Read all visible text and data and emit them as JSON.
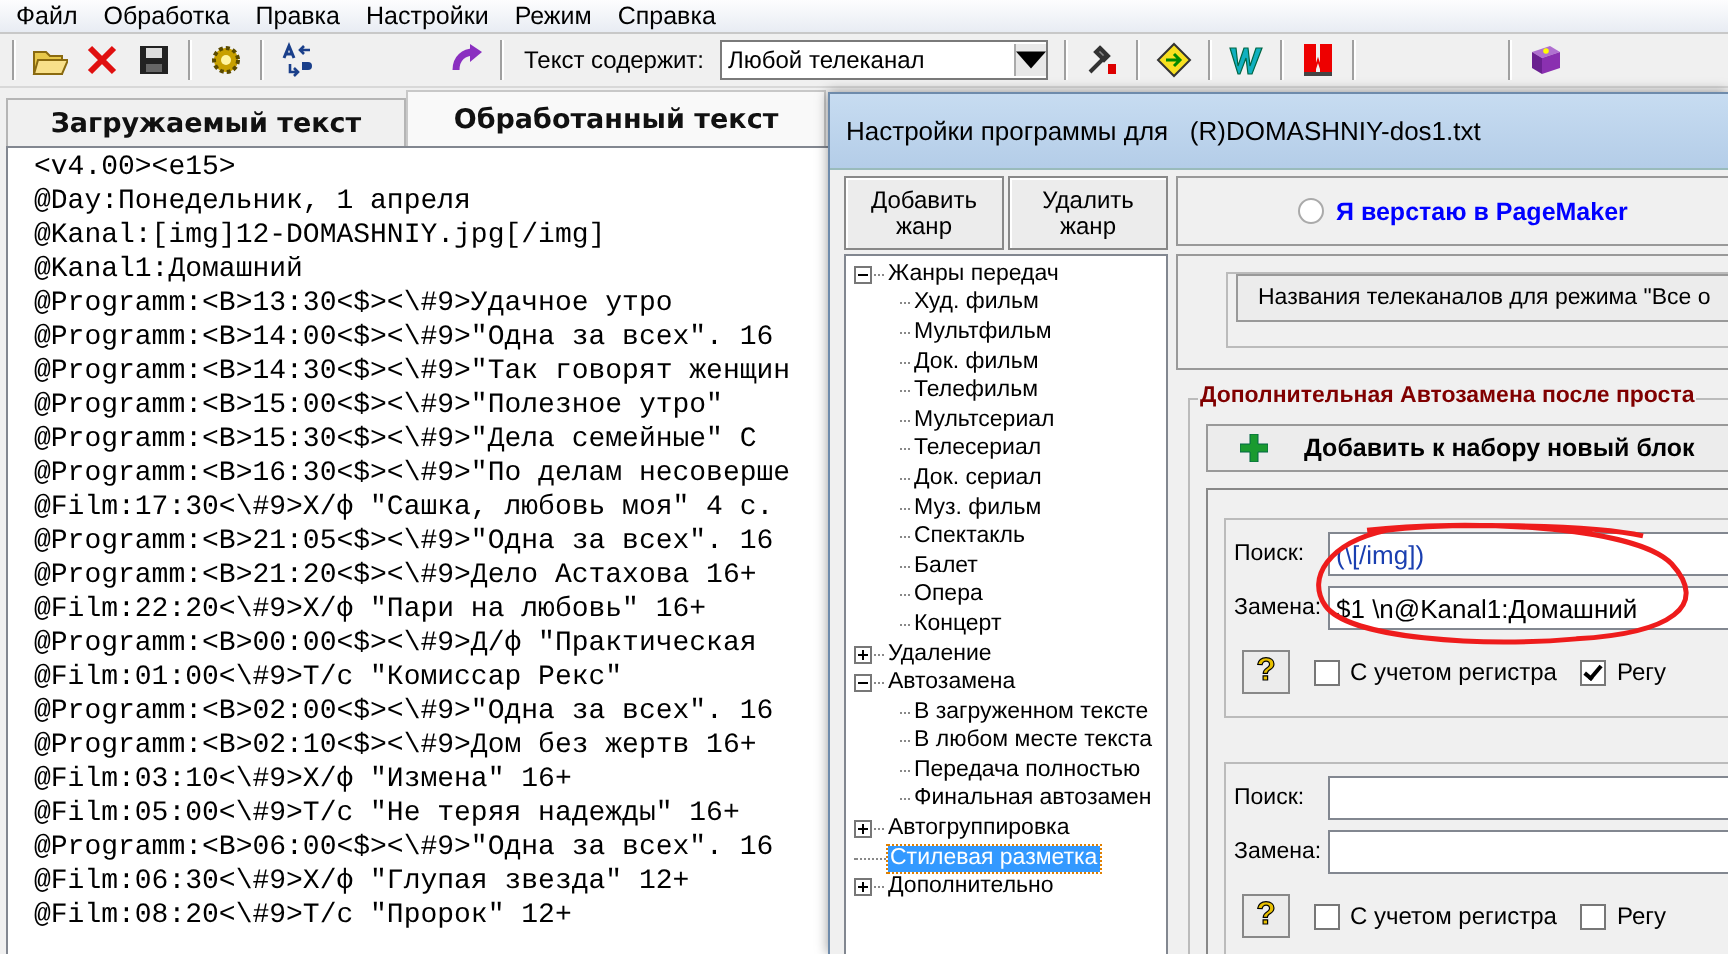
{
  "menu": [
    "Файл",
    "Обработка",
    "Правка",
    "Настройки",
    "Режим",
    "Справка"
  ],
  "toolbar": {
    "filter_label": "Текст содержит:",
    "filter_value": "Любой телеканал"
  },
  "tabs": [
    {
      "label": "Загружаемый текст",
      "selected": false
    },
    {
      "label": "Обработанный текст",
      "selected": true
    }
  ],
  "editor": {
    "lines": [
      "<v4.00><e15>",
      "@Day:Понедельник, 1 апреля",
      "@Kanal:[img]12-DOMASHNIY.jpg[/img]",
      "@Kanal1:Домашний",
      "@Programm:<B>13:30<$><\\#9>Удачное утро",
      "@Programm:<B>14:00<$><\\#9>\"Одна за всех\". 16",
      "@Programm:<B>14:30<$><\\#9>\"Так говорят женщин",
      "@Programm:<B>15:00<$><\\#9>\"Полезное утро\"",
      "@Programm:<B>15:30<$><\\#9>\"Дела семейные\" С",
      "@Programm:<B>16:30<$><\\#9>\"По делам несоверше",
      "@Film:17:30<\\#9>Х/ф \"Сашка, любовь моя\" 4 с.",
      "@Programm:<B>21:05<$><\\#9>\"Одна за всех\". 16",
      "@Programm:<B>21:20<$><\\#9>Дело Астахова 16+",
      "@Film:22:20<\\#9>Х/ф \"Пари на любовь\" 16+",
      "@Programm:<B>00:00<$><\\#9>Д/ф \"Практическая",
      "@Film:01:00<\\#9>Т/с \"Комиссар Рекс\"",
      "@Programm:<B>02:00<$><\\#9>\"Одна за всех\". 16",
      "@Programm:<B>02:10<$><\\#9>Дом без жертв 16+",
      "@Film:03:10<\\#9>Х/ф \"Измена\" 16+",
      "@Film:05:00<\\#9>Т/с \"Не теряя надежды\" 16+",
      "@Programm:<B>06:00<$><\\#9>\"Одна за всех\". 16",
      "@Film:06:30<\\#9>Х/ф \"Глупая звезда\" 12+",
      "@Film:08:20<\\#9>Т/с \"Пророк\" 12+"
    ]
  },
  "dialog": {
    "title": "Настройки программы для   (R)DOMASHNIY-dos1.txt",
    "genre_buttons": [
      "Добавить жанр",
      "Удалить жанр"
    ],
    "tree": [
      {
        "label": "Жанры передач",
        "expanded": true,
        "selected": false,
        "children": [
          {
            "label": "Худ. фильм",
            "selected": false
          },
          {
            "label": "Мультфильм",
            "selected": false
          },
          {
            "label": "Док. фильм",
            "selected": false
          },
          {
            "label": "Телефильм",
            "selected": false
          },
          {
            "label": "Мультсериал",
            "selected": false
          },
          {
            "label": "Телесериал",
            "selected": false
          },
          {
            "label": "Док. сериал",
            "selected": false
          },
          {
            "label": "Муз. фильм",
            "selected": false
          },
          {
            "label": "Спектакль",
            "selected": false
          },
          {
            "label": "Балет",
            "selected": false
          },
          {
            "label": "Опера",
            "selected": false
          },
          {
            "label": "Концерт",
            "selected": false
          }
        ]
      },
      {
        "label": "Удаление",
        "expanded": false,
        "selected": false
      },
      {
        "label": "Автозамена",
        "expanded": true,
        "selected": false,
        "children": [
          {
            "label": "В загруженном тексте",
            "selected": false
          },
          {
            "label": "В любом месте текста",
            "selected": false
          },
          {
            "label": "Передача полностью",
            "selected": false
          },
          {
            "label": "Финальная автозамен",
            "selected": false
          }
        ]
      },
      {
        "label": "Автогруппировка",
        "expanded": false,
        "selected": false
      },
      {
        "label": "Стилевая разметка",
        "selected": true
      },
      {
        "label": "Дополнительно",
        "expanded": false,
        "selected": false
      }
    ],
    "pagemaker_radio": {
      "label": "Я верстаю в PageMaker",
      "selected": false
    },
    "channel_names_button": "Названия телеканалов для режима \"Все о",
    "autoreplace": {
      "title": "Дополнительная Автозамена после проста",
      "add_button": "Добавить к набору новый блок",
      "blocks": [
        {
          "search_label": "Поиск:",
          "search": "(\\[/img])",
          "replace_label": "Замена:",
          "replace": "$1 \\n@Kanal1:Домашний",
          "help": "?",
          "case_label": "С учетом регистра",
          "case_sensitive": false,
          "regex_label": "Регу",
          "regex": true
        },
        {
          "search_label": "Поиск:",
          "replace_label": "Замена:",
          "help": "?",
          "case_label": "С учетом регистра",
          "case_sensitive": false,
          "regex_label": "Регу",
          "regex": false
        }
      ]
    }
  }
}
